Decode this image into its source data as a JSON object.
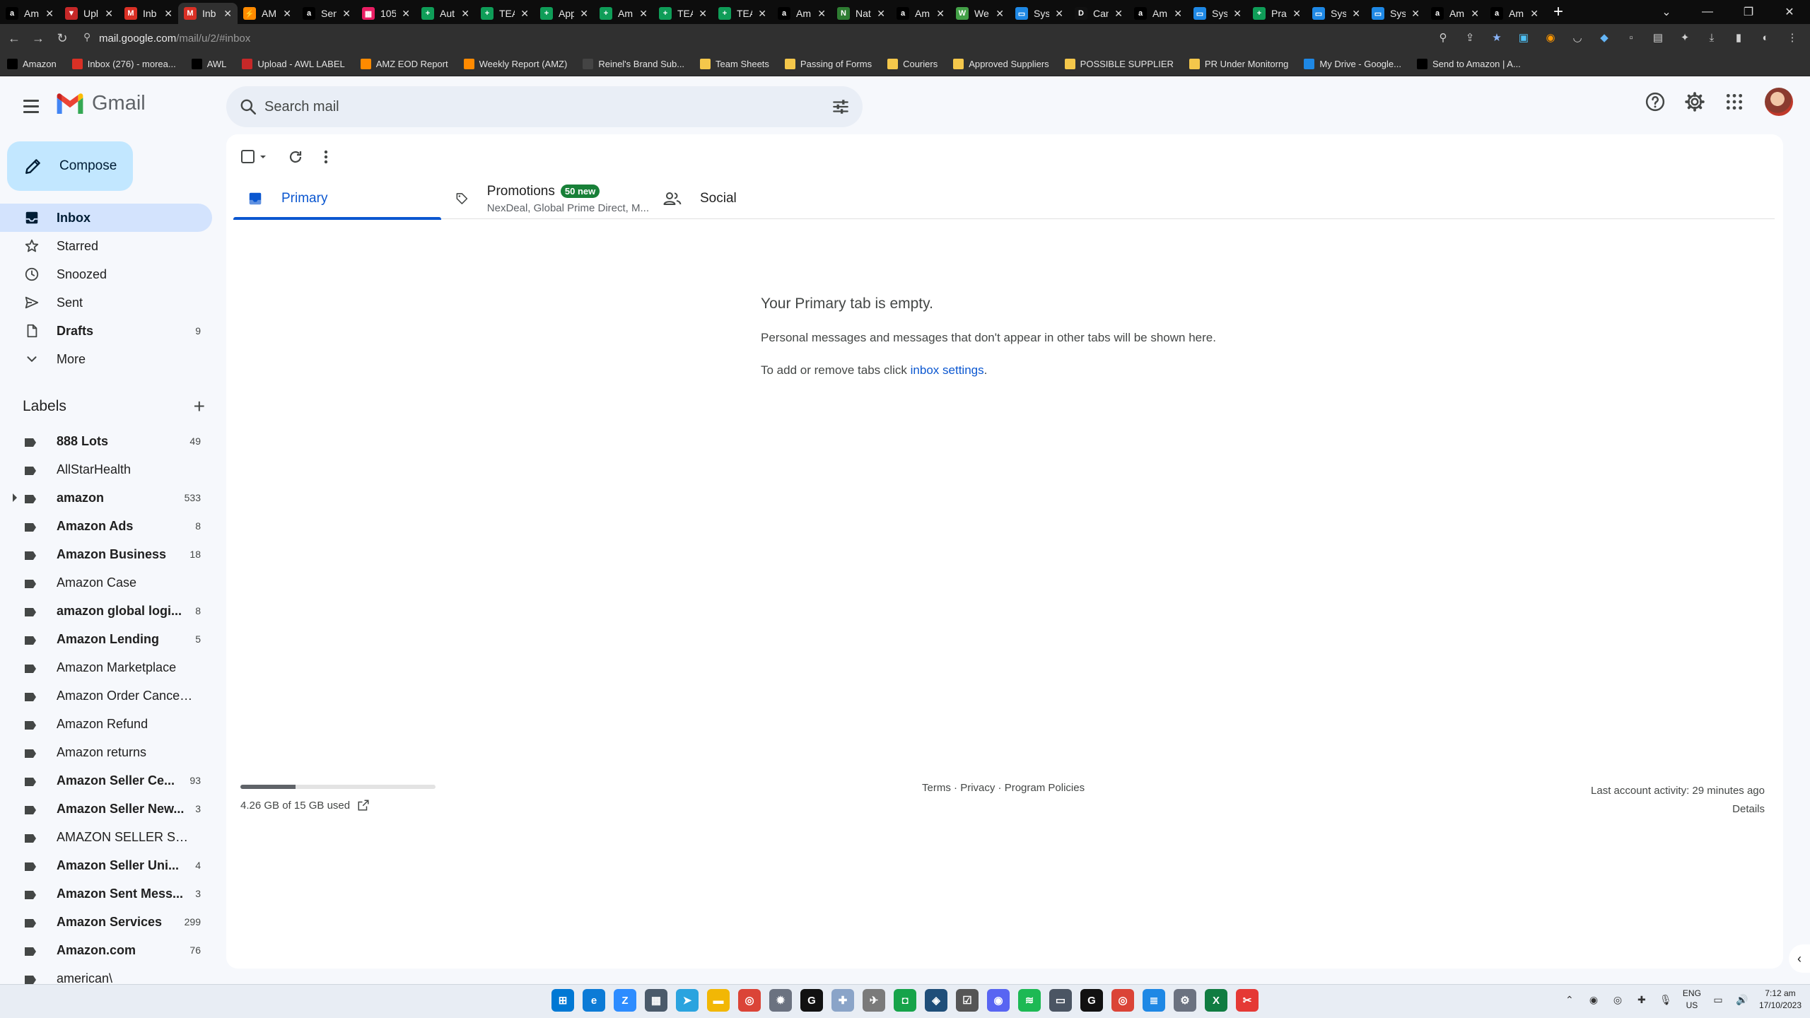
{
  "browser": {
    "tabs": [
      {
        "title": "Am",
        "color": "#000000",
        "glyph": "a"
      },
      {
        "title": "Upl",
        "color": "#c62828",
        "glyph": "▼"
      },
      {
        "title": "Inb",
        "color": "#d93025",
        "glyph": "M"
      },
      {
        "title": "Inb",
        "color": "#d93025",
        "glyph": "M"
      },
      {
        "title": "AM",
        "color": "#ff8a00",
        "glyph": "⚡"
      },
      {
        "title": "Sen",
        "color": "#000000",
        "glyph": "a"
      },
      {
        "title": "105",
        "color": "#e91e63",
        "glyph": "▦"
      },
      {
        "title": "Aut",
        "color": "#0f9d58",
        "glyph": "+"
      },
      {
        "title": "TEA",
        "color": "#0f9d58",
        "glyph": "+"
      },
      {
        "title": "App",
        "color": "#0f9d58",
        "glyph": "+"
      },
      {
        "title": "Am",
        "color": "#0f9d58",
        "glyph": "+"
      },
      {
        "title": "TEA",
        "color": "#0f9d58",
        "glyph": "+"
      },
      {
        "title": "TEA",
        "color": "#0f9d58",
        "glyph": "+"
      },
      {
        "title": "Am",
        "color": "#000000",
        "glyph": "a"
      },
      {
        "title": "Nat",
        "color": "#2e7d32",
        "glyph": "N"
      },
      {
        "title": "Am",
        "color": "#000000",
        "glyph": "a"
      },
      {
        "title": "We",
        "color": "#43a047",
        "glyph": "W"
      },
      {
        "title": "Sys",
        "color": "#1e88e5",
        "glyph": "▭"
      },
      {
        "title": "Can",
        "color": "#111111",
        "glyph": "D"
      },
      {
        "title": "Am",
        "color": "#000000",
        "glyph": "a"
      },
      {
        "title": "Sys",
        "color": "#1e88e5",
        "glyph": "▭"
      },
      {
        "title": "Pra",
        "color": "#0f9d58",
        "glyph": "+"
      },
      {
        "title": "Sys",
        "color": "#1e88e5",
        "glyph": "▭"
      },
      {
        "title": "Sys",
        "color": "#1e88e5",
        "glyph": "▭"
      },
      {
        "title": "Am",
        "color": "#000000",
        "glyph": "a"
      },
      {
        "title": "Am",
        "color": "#000000",
        "glyph": "a"
      }
    ],
    "active_tab_index": 3,
    "url": {
      "host": "mail.google.com",
      "path": "/mail/u/2/#inbox"
    },
    "bookmarks": [
      {
        "label": "Amazon",
        "color": "#000000"
      },
      {
        "label": "Inbox (276) - morea...",
        "color": "#d93025"
      },
      {
        "label": "AWL",
        "color": "#000000"
      },
      {
        "label": "Upload - AWL LABEL",
        "color": "#c62828"
      },
      {
        "label": "AMZ EOD Report",
        "color": "#ff8a00"
      },
      {
        "label": "Weekly Report (AMZ)",
        "color": "#ff8a00"
      },
      {
        "label": "Reinel's Brand Sub...",
        "color": "#444444"
      },
      {
        "label": "Team Sheets",
        "color": "folder"
      },
      {
        "label": "Passing of Forms",
        "color": "folder"
      },
      {
        "label": "Couriers",
        "color": "folder"
      },
      {
        "label": "Approved Suppliers",
        "color": "folder"
      },
      {
        "label": "POSSIBLE SUPPLIER",
        "color": "folder"
      },
      {
        "label": "PR Under Monitorng",
        "color": "folder"
      },
      {
        "label": "My Drive - Google...",
        "color": "#1e88e5"
      },
      {
        "label": "Send to Amazon | A...",
        "color": "#000000"
      }
    ]
  },
  "gmail": {
    "logo_text": "Gmail",
    "search_placeholder": "Search mail",
    "compose_label": "Compose",
    "nav": [
      {
        "label": "Inbox",
        "count": "",
        "icon": "inbox-icon",
        "active": true,
        "bold": true
      },
      {
        "label": "Starred",
        "count": "",
        "icon": "star-icon",
        "active": false,
        "bold": false
      },
      {
        "label": "Snoozed",
        "count": "",
        "icon": "clock-icon",
        "active": false,
        "bold": false
      },
      {
        "label": "Sent",
        "count": "",
        "icon": "send-icon",
        "active": false,
        "bold": false
      },
      {
        "label": "Drafts",
        "count": "9",
        "icon": "draft-icon",
        "active": false,
        "bold": true
      },
      {
        "label": "More",
        "count": "",
        "icon": "chevron-down-icon",
        "active": false,
        "bold": false
      }
    ],
    "labels_heading": "Labels",
    "labels": [
      {
        "name": "888 Lots",
        "count": "49",
        "bold": true,
        "expandable": false
      },
      {
        "name": "AllStarHealth",
        "count": "",
        "bold": false,
        "expandable": false
      },
      {
        "name": "amazon",
        "count": "533",
        "bold": true,
        "expandable": true
      },
      {
        "name": "Amazon Ads",
        "count": "8",
        "bold": true,
        "expandable": false
      },
      {
        "name": "Amazon Business",
        "count": "18",
        "bold": true,
        "expandable": false
      },
      {
        "name": "Amazon Case",
        "count": "",
        "bold": false,
        "expandable": false
      },
      {
        "name": "amazon global logi...",
        "count": "8",
        "bold": true,
        "expandable": false
      },
      {
        "name": "Amazon Lending",
        "count": "5",
        "bold": true,
        "expandable": false
      },
      {
        "name": "Amazon Marketplace",
        "count": "",
        "bold": false,
        "expandable": false
      },
      {
        "name": "Amazon Order Cancella...",
        "count": "",
        "bold": false,
        "expandable": false
      },
      {
        "name": "Amazon Refund",
        "count": "",
        "bold": false,
        "expandable": false
      },
      {
        "name": "Amazon returns",
        "count": "",
        "bold": false,
        "expandable": false
      },
      {
        "name": "Amazon Seller Ce...",
        "count": "93",
        "bold": true,
        "expandable": false
      },
      {
        "name": "Amazon Seller New...",
        "count": "3",
        "bold": true,
        "expandable": false
      },
      {
        "name": "AMAZON SELLER SUPP...",
        "count": "",
        "bold": false,
        "expandable": false
      },
      {
        "name": "Amazon Seller Uni...",
        "count": "4",
        "bold": true,
        "expandable": false
      },
      {
        "name": "Amazon Sent Mess...",
        "count": "3",
        "bold": true,
        "expandable": false
      },
      {
        "name": "Amazon Services",
        "count": "299",
        "bold": true,
        "expandable": false
      },
      {
        "name": "Amazon.com",
        "count": "76",
        "bold": true,
        "expandable": false
      },
      {
        "name": "american\\",
        "count": "",
        "bold": false,
        "expandable": false
      }
    ],
    "tabs": {
      "primary": "Primary",
      "promotions": "Promotions",
      "promotions_badge": "50 new",
      "promotions_sub": "NexDeal, Global Prime Direct, M...",
      "social": "Social"
    },
    "empty": {
      "title": "Your Primary tab is empty.",
      "desc": "Personal messages and messages that don't appear in other tabs will be shown here.",
      "tip_prefix": "To add or remove tabs click ",
      "tip_link": "inbox settings",
      "tip_suffix": "."
    },
    "storage": {
      "text": "4.26 GB of 15 GB used",
      "fraction": 0.284
    },
    "footer": {
      "terms": "Terms",
      "privacy": "Privacy",
      "policies": "Program Policies",
      "sep": " · "
    },
    "activity": {
      "text": "Last account activity: 29 minutes ago",
      "details": "Details"
    }
  },
  "taskbar": {
    "apps": [
      {
        "name": "windows",
        "color": "#0078d4",
        "glyph": "⊞"
      },
      {
        "name": "edge",
        "color": "#0c7bd6",
        "glyph": "e"
      },
      {
        "name": "zoom",
        "color": "#2d8cff",
        "glyph": "Z"
      },
      {
        "name": "calculator",
        "color": "#4a5a6a",
        "glyph": "▦"
      },
      {
        "name": "telegram",
        "color": "#2aa3df",
        "glyph": "➤"
      },
      {
        "name": "explorer",
        "color": "#f2b705",
        "glyph": "▬"
      },
      {
        "name": "chrome",
        "color": "#db4437",
        "glyph": "◎"
      },
      {
        "name": "settings",
        "color": "#6b7280",
        "glyph": "✹"
      },
      {
        "name": "app-g1",
        "color": "#111111",
        "glyph": "G"
      },
      {
        "name": "app-plus",
        "color": "#8aa4c8",
        "glyph": "✚"
      },
      {
        "name": "app-bird",
        "color": "#7a7a7a",
        "glyph": "✈"
      },
      {
        "name": "app-green",
        "color": "#16a34a",
        "glyph": "◘"
      },
      {
        "name": "app-box",
        "color": "#1f4e79",
        "glyph": "◈"
      },
      {
        "name": "app-check",
        "color": "#555555",
        "glyph": "☑"
      },
      {
        "name": "discord",
        "color": "#5865f2",
        "glyph": "◉"
      },
      {
        "name": "spotify",
        "color": "#1db954",
        "glyph": "≋"
      },
      {
        "name": "app-monitor",
        "color": "#4b5563",
        "glyph": "▭"
      },
      {
        "name": "app-g2",
        "color": "#111111",
        "glyph": "G"
      },
      {
        "name": "chrome-2",
        "color": "#db4437",
        "glyph": "◎"
      },
      {
        "name": "app-notes",
        "color": "#1e88e5",
        "glyph": "≣"
      },
      {
        "name": "settings-2",
        "color": "#6b7280",
        "glyph": "⚙"
      },
      {
        "name": "excel",
        "color": "#107c41",
        "glyph": "X"
      },
      {
        "name": "snip",
        "color": "#e53935",
        "glyph": "✂"
      }
    ],
    "lang": {
      "top": "ENG",
      "bottom": "US"
    },
    "clock": {
      "time": "7:12 am",
      "date": "17/10/2023"
    }
  }
}
